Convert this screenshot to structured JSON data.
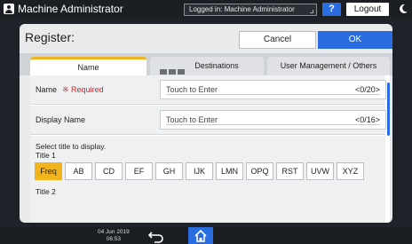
{
  "header": {
    "app_title": "Machine Administrator",
    "login_status": "Logged in: Machine Administrator",
    "help_label": "?",
    "logout_label": "Logout"
  },
  "dialog": {
    "title": "Register:",
    "cancel_label": "Cancel",
    "ok_label": "OK"
  },
  "tabs": [
    {
      "label": "Name",
      "active": true
    },
    {
      "label": "Destinations",
      "active": false
    },
    {
      "label": "User Management / Others",
      "active": false
    }
  ],
  "fields": {
    "name": {
      "label": "Name",
      "required_text": "※ Required",
      "placeholder": "Touch to Enter",
      "counter": "<0/20>"
    },
    "display_name": {
      "label": "Display Name",
      "placeholder": "Touch to Enter",
      "counter": "<0/16>"
    }
  },
  "title_section": {
    "hint": "Select title to display.",
    "title1_label": "Title 1",
    "keys": [
      "Freq",
      "AB",
      "CD",
      "EF",
      "GH",
      "IJK",
      "LMN",
      "OPQ",
      "RST",
      "UVW",
      "XYZ"
    ],
    "selected_key": "Freq",
    "title2_label": "Title 2"
  },
  "footer": {
    "date": "04 Jun 2019",
    "time": "06:53"
  },
  "colors": {
    "accent_blue": "#2a6de0",
    "tab_highlight": "#f0b51e",
    "required_red": "#d3262f"
  }
}
